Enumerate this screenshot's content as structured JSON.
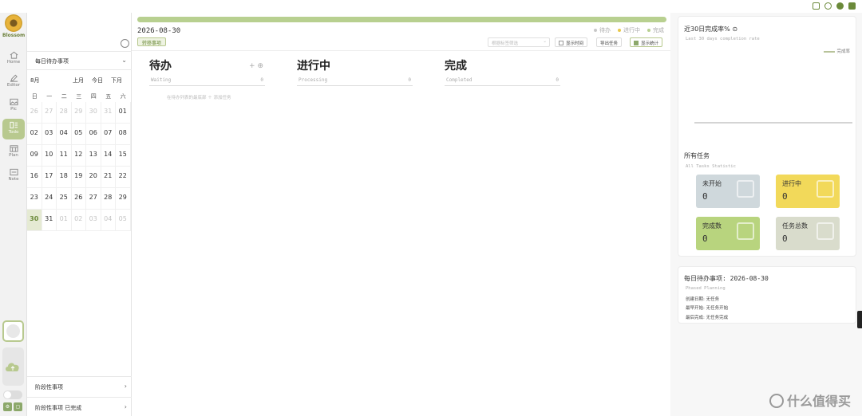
{
  "app": {
    "name": "Blossom"
  },
  "nav": [
    {
      "label": "Home",
      "icon": "home-icon"
    },
    {
      "label": "Editor",
      "icon": "editor-icon"
    },
    {
      "label": "Pic",
      "icon": "picture-icon"
    },
    {
      "label": "Todo",
      "icon": "todo-icon",
      "active": true
    },
    {
      "label": "Plan",
      "icon": "calendar-icon"
    },
    {
      "label": "Note",
      "icon": "note-icon"
    }
  ],
  "calendar": {
    "dropdown_label": "每日待办事项",
    "month": "8月",
    "prev": "上月",
    "today": "今日",
    "next": "下月",
    "weekdays": [
      "日",
      "一",
      "二",
      "三",
      "四",
      "五",
      "六"
    ],
    "days": [
      [
        "26",
        "27",
        "28",
        "29",
        "30",
        "31",
        "01"
      ],
      [
        "02",
        "03",
        "04",
        "05",
        "06",
        "07",
        "08"
      ],
      [
        "09",
        "10",
        "11",
        "12",
        "13",
        "14",
        "15"
      ],
      [
        "16",
        "17",
        "18",
        "19",
        "20",
        "21",
        "22"
      ],
      [
        "23",
        "24",
        "25",
        "26",
        "27",
        "28",
        "29"
      ],
      [
        "30",
        "31",
        "01",
        "02",
        "03",
        "04",
        "05"
      ]
    ],
    "phase": "阶段性事项",
    "phase_done": "阶段性事项 已完成"
  },
  "board": {
    "date": "2026-08-30",
    "migrate": "转移事项",
    "filter_placeholder": "根据标签筛选",
    "show_time": "显示时间",
    "export": "导出任务",
    "show_stats": "显示统计",
    "legend": [
      {
        "label": "待办",
        "color": "#c8c8c8"
      },
      {
        "label": "进行中",
        "color": "#e8c84a"
      },
      {
        "label": "完成",
        "color": "#b8d090"
      }
    ],
    "columns": [
      {
        "title": "待办",
        "sub": "Waiting",
        "count": "0",
        "add": "+",
        "menu": "⊕"
      },
      {
        "title": "进行中",
        "sub": "Processing",
        "count": "0"
      },
      {
        "title": "完成",
        "sub": "Completed",
        "count": "0"
      }
    ],
    "add_hint": "在待办列表的最底部 ＋ 添加任务"
  },
  "stats": {
    "rate_title": "近30日完成率%",
    "rate_sub": "Last 30 days completion rate",
    "rate_legend": "完成率",
    "all_title": "所有任务",
    "all_sub": "All Tasks Statistic",
    "cards": [
      {
        "label": "未开始",
        "value": "0",
        "color": "#cfd8dc"
      },
      {
        "label": "进行中",
        "value": "0",
        "color": "#f2d95a"
      },
      {
        "label": "完成数",
        "value": "0",
        "color": "#b8d47e"
      },
      {
        "label": "任务总数",
        "value": "0",
        "color": "#d9dccc"
      }
    ],
    "daily_title": "每日待办事项: 2026-08-30",
    "daily_sub": "Phased Planning",
    "created": "创建日期: 无任务",
    "earliest": "最早开始: 无任务开始",
    "latest": "最后完成: 无任务完成"
  },
  "watermark": "什么值得买"
}
